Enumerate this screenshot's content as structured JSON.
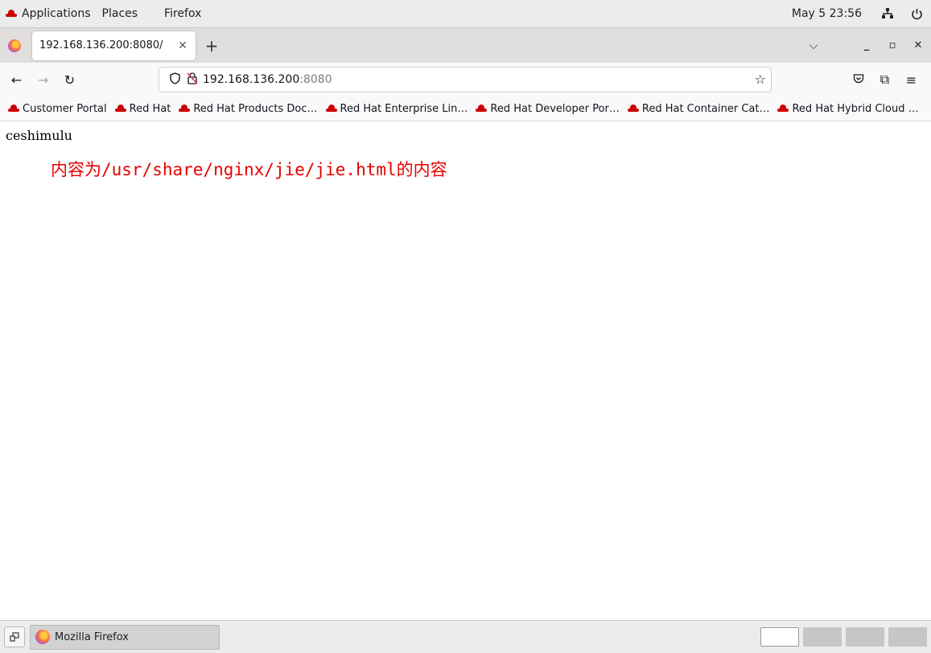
{
  "topbar": {
    "applications_label": "Applications",
    "places_label": "Places",
    "app_label": "Firefox",
    "clock": "May 5  23:56"
  },
  "tabs": [
    {
      "title": "192.168.136.200:8080/"
    }
  ],
  "toolbar": {
    "url_host": "192.168.136.200",
    "url_port": ":8080"
  },
  "bookmarks": [
    {
      "label": "Customer Portal"
    },
    {
      "label": "Red Hat"
    },
    {
      "label": "Red Hat Products Doc…"
    },
    {
      "label": "Red Hat Enterprise Lin…"
    },
    {
      "label": "Red Hat Developer Por…"
    },
    {
      "label": "Red Hat Container Cat…"
    },
    {
      "label": "Red Hat Hybrid Cloud …"
    }
  ],
  "page": {
    "heading": "ceshimulu",
    "message": "内容为/usr/share/nginx/jie/jie.html的内容",
    "message_color": "#e60000"
  },
  "taskbar": {
    "window_label": "Mozilla Firefox"
  },
  "colors": {
    "brand_red": "#cc0000",
    "accent_text": "#e60000"
  }
}
